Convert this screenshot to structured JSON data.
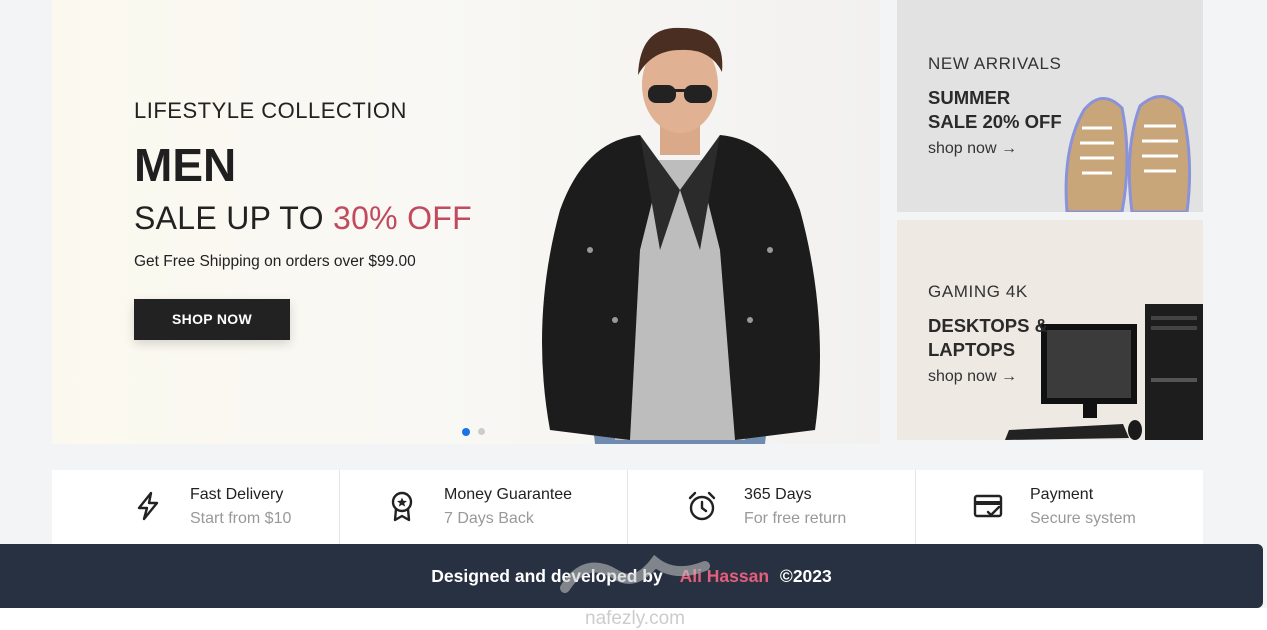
{
  "hero": {
    "subtitle": "LIFESTYLE COLLECTION",
    "title": "MEN",
    "sale_prefix": "SALE UP TO",
    "sale_accent": "30% OFF",
    "shipping": "Get Free Shipping on orders over $99.00",
    "cta": "SHOP NOW",
    "accent_color": "#c24a5f",
    "slides": {
      "count": 2,
      "active": 1
    }
  },
  "promos": [
    {
      "kicker": "NEW ARRIVALS",
      "headline": "SUMMER\nSALE 20% OFF",
      "link": "shop now →",
      "image": "sneakers"
    },
    {
      "kicker": "GAMING 4K",
      "headline": "DESKTOPS &\nLAPTOPS",
      "link": "shop now →",
      "image": "desktop-computer"
    }
  ],
  "features": [
    {
      "icon": "lightning-icon",
      "title": "Fast Delivery",
      "subtitle": "Start from $10"
    },
    {
      "icon": "award-badge-icon",
      "title": "Money Guarantee",
      "subtitle": "7 Days Back"
    },
    {
      "icon": "alarm-clock-icon",
      "title": "365 Days",
      "subtitle": "For free return"
    },
    {
      "icon": "credit-card-icon",
      "title": "Payment",
      "subtitle": "Secure system"
    }
  ],
  "footer": {
    "text": "Designed and developed by",
    "name": "Ali Hassan",
    "copyright": "©2023",
    "name_color": "#e55e7b"
  },
  "watermark": {
    "text": "nafezly.com"
  }
}
